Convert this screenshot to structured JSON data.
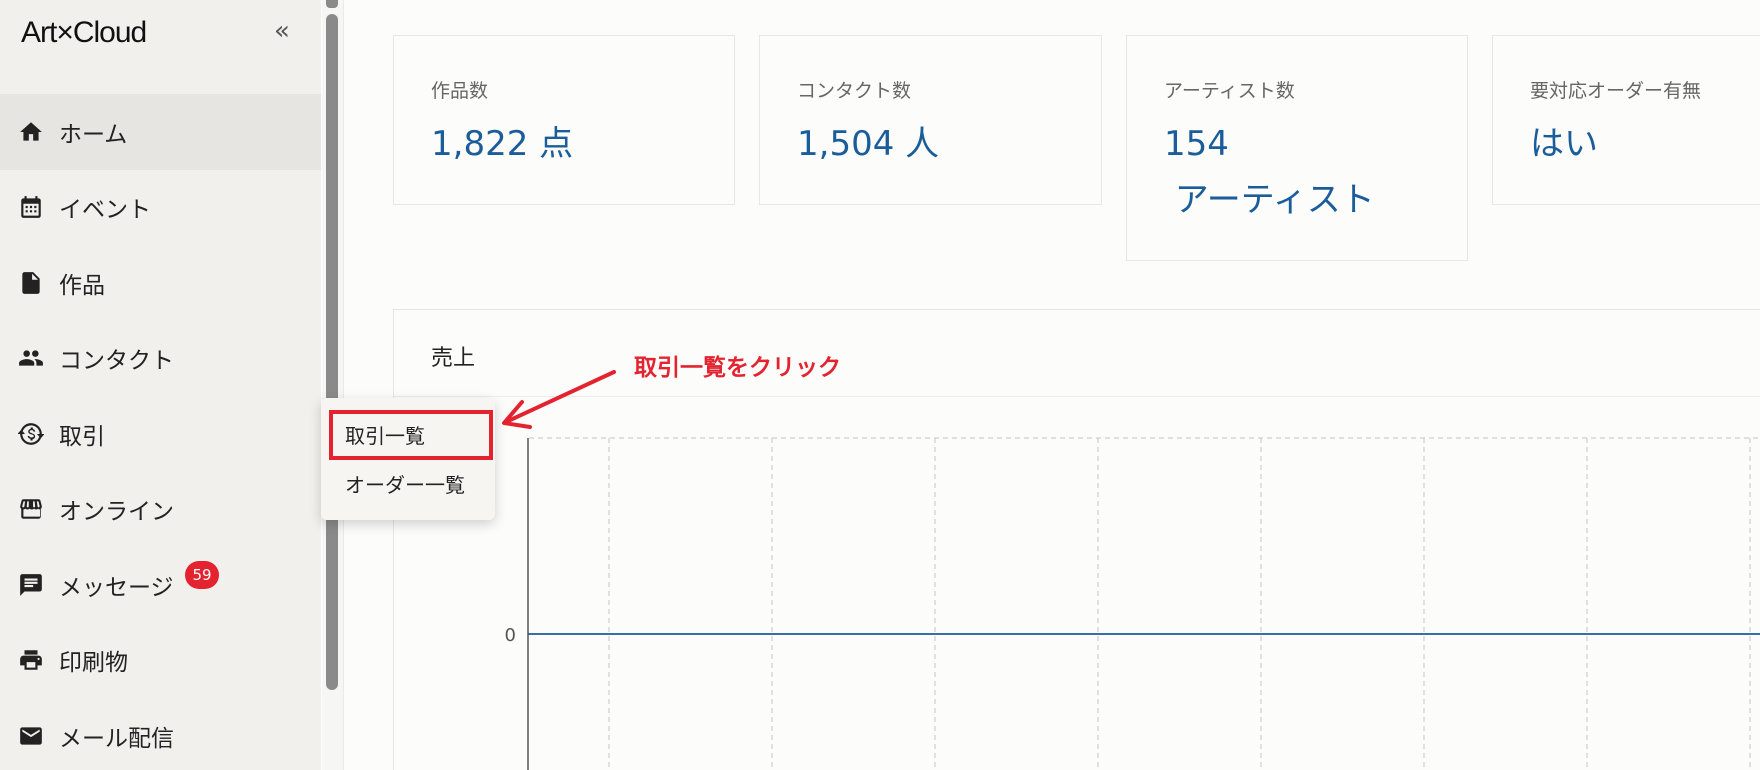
{
  "brand": {
    "logo": "Art×Cloud"
  },
  "sidebar": {
    "collapse_label": "«",
    "items": [
      {
        "label": "ホーム",
        "icon": "home-icon",
        "active": true
      },
      {
        "label": "イベント",
        "icon": "calendar-icon"
      },
      {
        "label": "作品",
        "icon": "document-icon"
      },
      {
        "label": "コンタクト",
        "icon": "people-icon"
      },
      {
        "label": "取引",
        "icon": "transaction-icon"
      },
      {
        "label": "オンライン",
        "icon": "storefront-icon"
      },
      {
        "label": "メッセージ",
        "icon": "message-icon",
        "badge": "59"
      },
      {
        "label": "印刷物",
        "icon": "printer-icon"
      },
      {
        "label": "メール配信",
        "icon": "mail-icon"
      }
    ]
  },
  "stats": [
    {
      "label": "作品数",
      "value": "1,822 点"
    },
    {
      "label": "コンタクト数",
      "value": "1,504 人"
    },
    {
      "label": "アーティスト数",
      "value": "154\n アーティスト"
    },
    {
      "label": "要対応オーダー有無",
      "value": "はい"
    }
  ],
  "sales": {
    "title": "売上",
    "y_tick": "0"
  },
  "submenu": {
    "items": [
      "取引一覧",
      "オーダー一覧"
    ]
  },
  "annotation": {
    "text": "取引一覧をクリック",
    "color": "#e3232f"
  },
  "colors": {
    "accent": "#1b5d9a",
    "badge": "#e3232f"
  }
}
